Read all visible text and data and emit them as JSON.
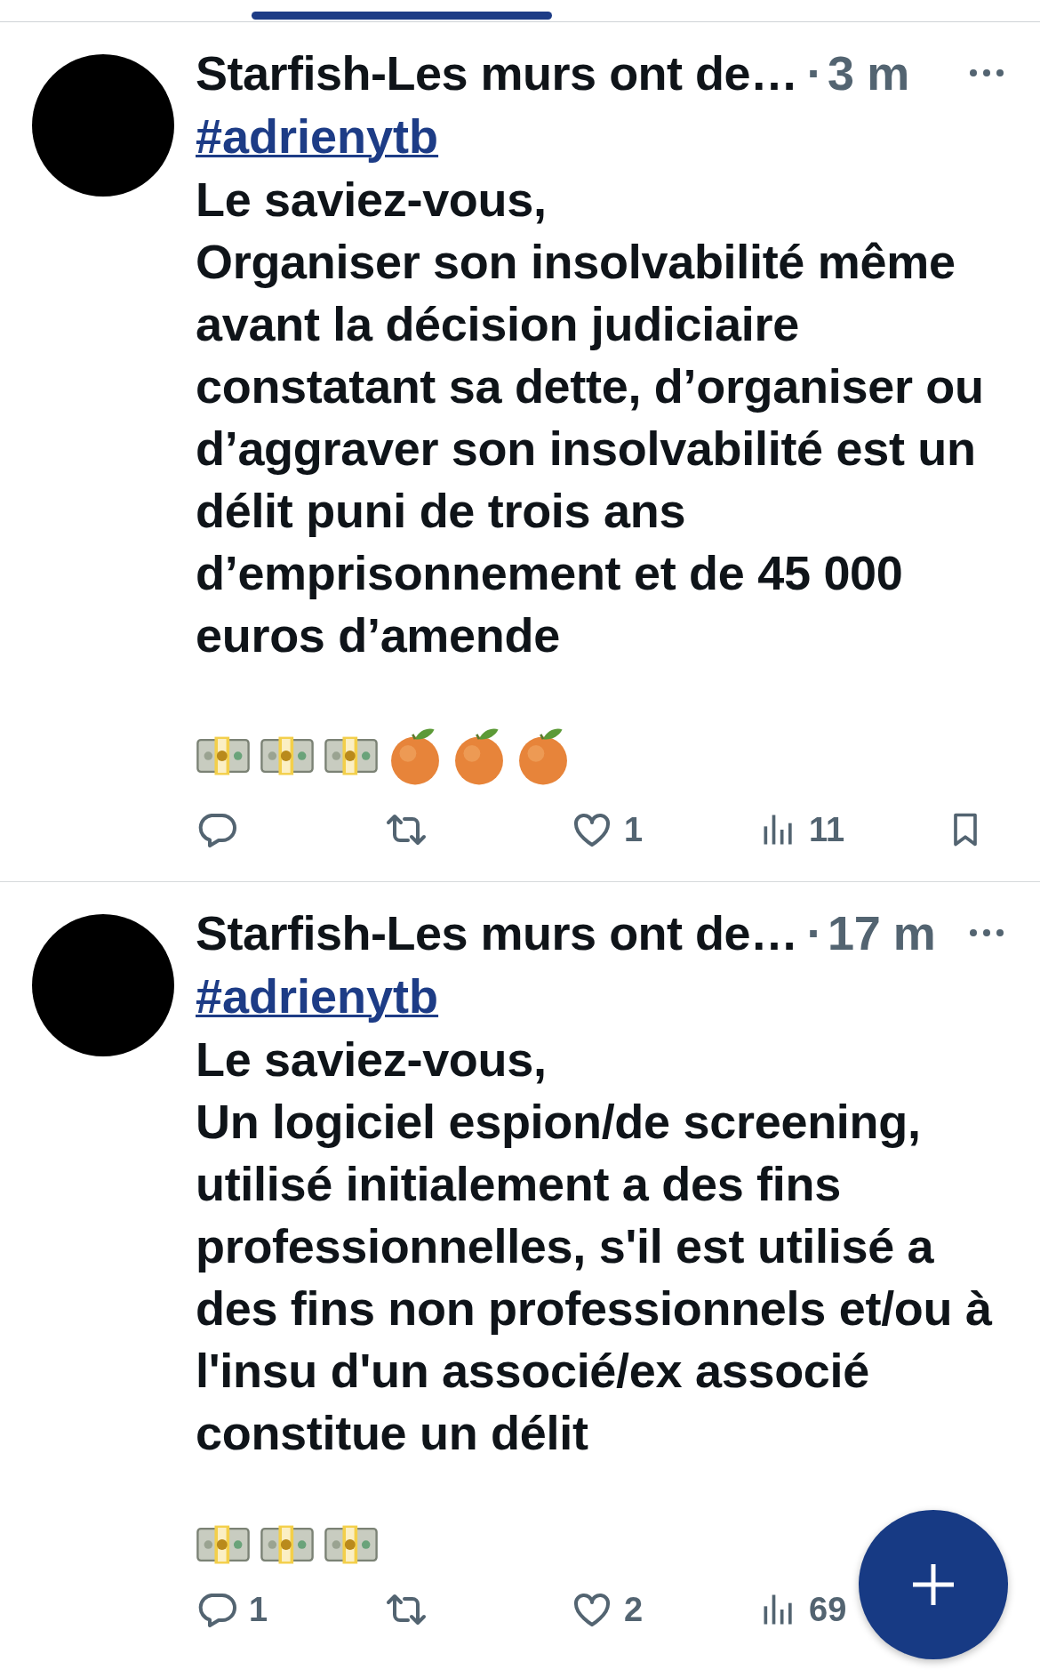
{
  "posts": [
    {
      "author": "Starfish-Les murs ont de…",
      "separator": "·",
      "time": "3 m",
      "hashtag": "#adrienytb",
      "paragraphs": [
        "Le saviez-vous,",
        "Organiser son insolvabilité même avant la décision judiciaire constatant sa dette, d’organiser ou d’aggraver son insolvabilité est un délit puni de trois ans d’emprisonnement et de 45 000 euros d’amende"
      ],
      "emojis": [
        {
          "kind": "money"
        },
        {
          "kind": "money"
        },
        {
          "kind": "money"
        },
        {
          "kind": "orange"
        },
        {
          "kind": "orange"
        },
        {
          "kind": "orange"
        }
      ],
      "actions": [
        {
          "kind": "reply"
        },
        {
          "kind": "repost"
        },
        {
          "kind": "like",
          "count": "1"
        },
        {
          "kind": "views",
          "count": "11"
        },
        {
          "kind": "bookmark"
        }
      ]
    },
    {
      "author": "Starfish-Les murs ont de…",
      "separator": "·",
      "time": "17 m",
      "hashtag": "#adrienytb",
      "paragraphs": [
        "Le saviez-vous,",
        "Un logiciel espion/de screening, utilisé initialement a des fins professionnelles, s'il est utilisé a des fins non professionnels et/ou à l'insu d'un associé/ex associé constitue un délit"
      ],
      "emojis": [
        {
          "kind": "money"
        },
        {
          "kind": "money"
        },
        {
          "kind": "money"
        }
      ],
      "actions": [
        {
          "kind": "reply",
          "count": "1"
        },
        {
          "kind": "repost"
        },
        {
          "kind": "like",
          "count": "2"
        },
        {
          "kind": "views",
          "count": "69"
        }
      ]
    }
  ]
}
